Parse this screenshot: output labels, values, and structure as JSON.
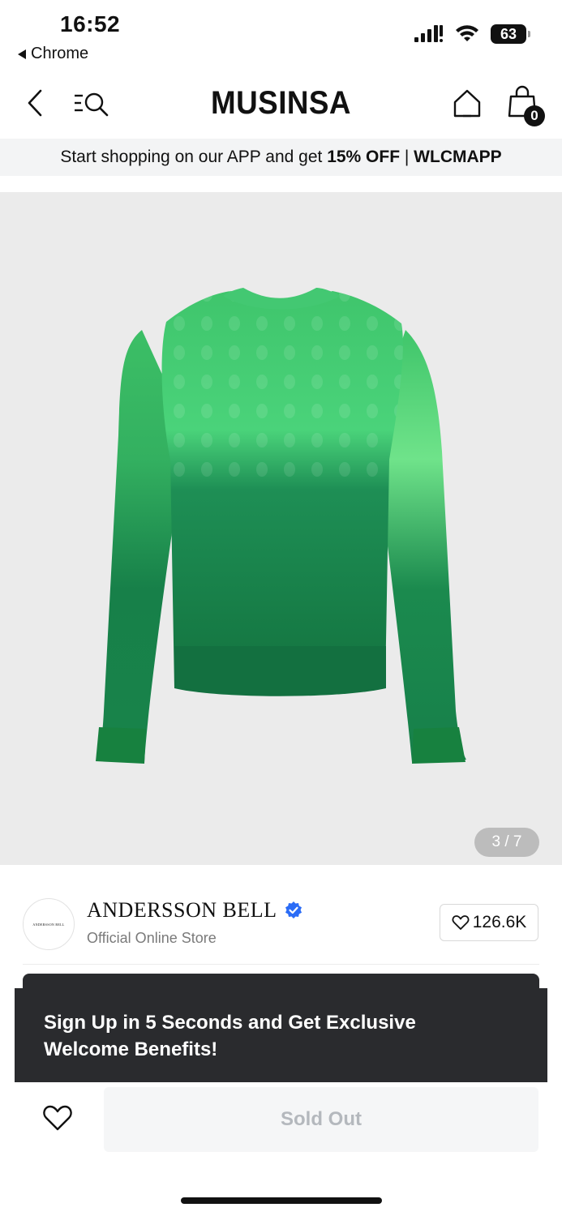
{
  "status_bar": {
    "time": "16:52",
    "back_app": "Chrome",
    "battery": "63"
  },
  "header": {
    "logo": "MUSINSA",
    "cart_count": "0"
  },
  "promo": {
    "prefix": "Start shopping on our APP and get ",
    "highlight": "15% OFF",
    "separator": " | ",
    "code": "WLCMAPP"
  },
  "gallery": {
    "counter": "3 / 7",
    "product_colors": [
      "#4fd17a",
      "#1a8a4e",
      "#0f6a3a"
    ]
  },
  "brand": {
    "name": "ANDERSSON BELL",
    "subtitle": "Official Online Store",
    "likes": "126.6K",
    "logo_text": "ANDERSSON BELL",
    "verified_color": "#2b6cf6"
  },
  "toast": {
    "line1": "Sign Up in 5 Seconds and Get Exclusive",
    "line2": "Welcome Benefits!"
  },
  "bottom": {
    "soldout_label": "Sold Out"
  },
  "icons": [
    "chevron-left-icon",
    "menu-search-icon",
    "home-icon",
    "shopping-bag-icon",
    "heart-icon",
    "verified-badge-icon",
    "signal-icon",
    "wifi-icon",
    "battery-icon"
  ]
}
